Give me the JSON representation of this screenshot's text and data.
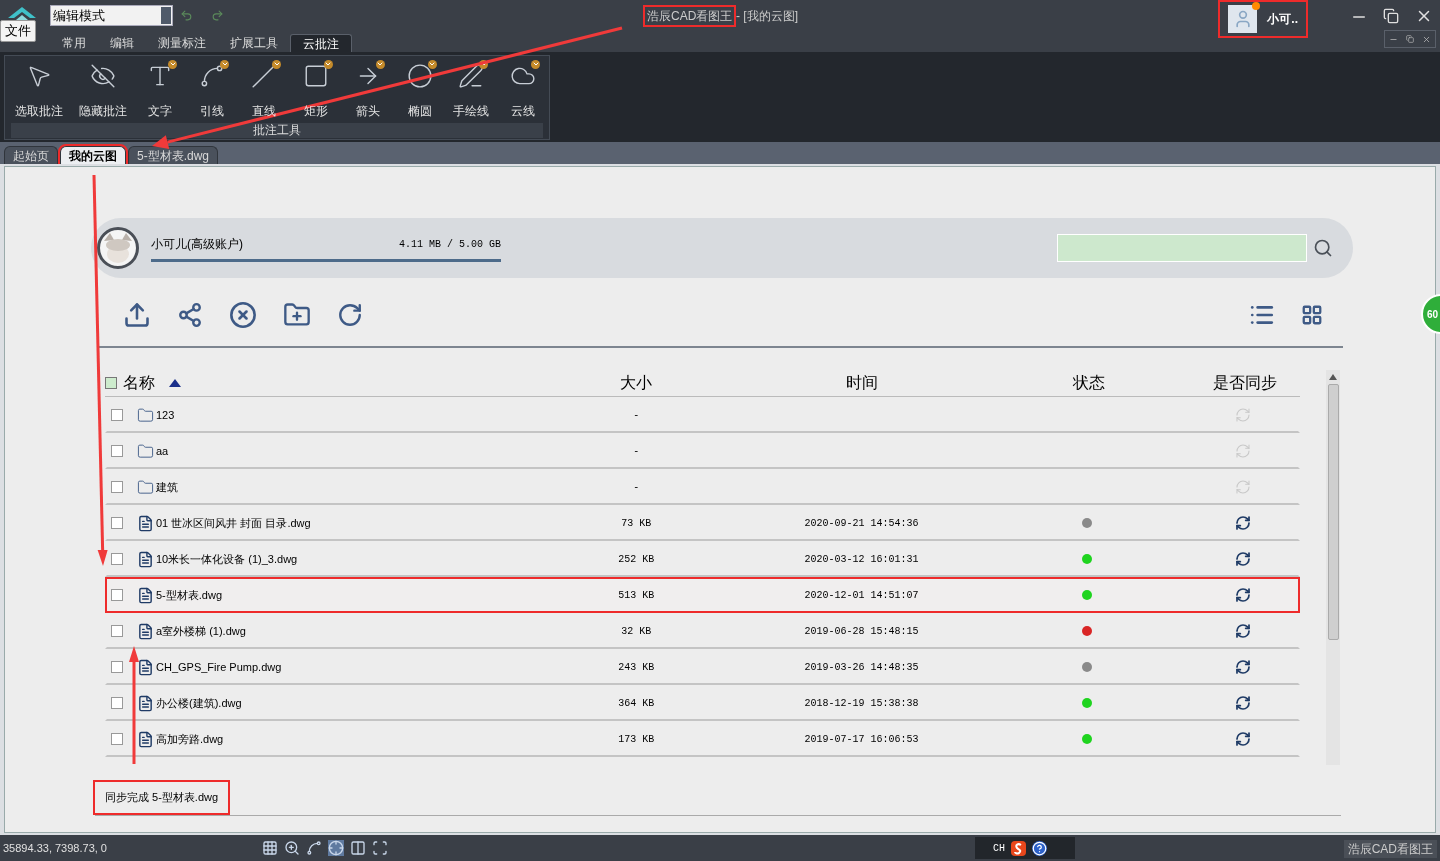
{
  "app": {
    "mode_select": "编辑模式",
    "title": {
      "text": "浩辰CAD看图王",
      "highlighted": true
    },
    "title_suffix": "- [我的云图]",
    "user": {
      "name": "小可..",
      "highlighted": true,
      "notification": true
    }
  },
  "file_button": "文件",
  "menu_tabs": [
    {
      "label": "常用",
      "selected": false
    },
    {
      "label": "编辑",
      "selected": false
    },
    {
      "label": "测量标注",
      "selected": false
    },
    {
      "label": "扩展工具",
      "selected": false
    },
    {
      "label": "云批注",
      "selected": true
    }
  ],
  "ribbon": {
    "tools": [
      {
        "label": "选取批注",
        "has_options": false
      },
      {
        "label": "隐藏批注",
        "has_options": false
      },
      {
        "label": "文字",
        "has_options": true
      },
      {
        "label": "引线",
        "has_options": true
      },
      {
        "label": "直线",
        "has_options": true
      },
      {
        "label": "矩形",
        "has_options": true
      },
      {
        "label": "箭头",
        "has_options": true
      },
      {
        "label": "椭圆",
        "has_options": true
      },
      {
        "label": "手绘线",
        "has_options": true
      },
      {
        "label": "云线",
        "has_options": true
      }
    ],
    "group_label": "批注工具"
  },
  "doc_tabs": [
    {
      "label": "起始页",
      "selected": false,
      "highlighted": false
    },
    {
      "label": "我的云图",
      "selected": true,
      "highlighted": true
    },
    {
      "label": "5-型材表.dwg",
      "selected": false,
      "highlighted": false
    }
  ],
  "account": {
    "name": "小可儿(高级账户)",
    "storage": "4.11 MB / 5.00 GB"
  },
  "side_badge": "60",
  "table": {
    "select_all": {
      "checked": false
    },
    "columns": [
      {
        "label": "名称",
        "sorted": true
      },
      {
        "label": "大小",
        "sorted": false
      },
      {
        "label": "时间",
        "sorted": false
      },
      {
        "label": "状态",
        "sorted": false
      },
      {
        "label": "是否同步",
        "sorted": false
      }
    ],
    "rows": [
      {
        "kind": "folder",
        "name": "123",
        "size": "-",
        "checked": false,
        "sync_enabled": false,
        "highlighted": false
      },
      {
        "kind": "folder",
        "name": "aa",
        "size": "-",
        "checked": false,
        "sync_enabled": false,
        "highlighted": false
      },
      {
        "kind": "folder",
        "name": "建筑",
        "size": "-",
        "checked": false,
        "sync_enabled": false,
        "highlighted": false
      },
      {
        "kind": "file",
        "name": "01 世冰区间风井 封面 目录.dwg",
        "size": "73 KB",
        "time": "2020-09-21 14:54:36",
        "color": "#8a8a8a",
        "checked": false,
        "sync_enabled": true,
        "highlighted": false
      },
      {
        "kind": "file",
        "name": "10米长一体化设备 (1)_3.dwg",
        "size": "252 KB",
        "time": "2020-03-12 16:01:31",
        "color": "#1fd41f",
        "checked": false,
        "sync_enabled": true,
        "highlighted": false
      },
      {
        "kind": "file",
        "name": "5-型材表.dwg",
        "size": "513 KB",
        "time": "2020-12-01 14:51:07",
        "color": "#1fd41f",
        "checked": false,
        "sync_enabled": true,
        "highlighted": true
      },
      {
        "kind": "file",
        "name": "a室外楼梯 (1).dwg",
        "size": "32 KB",
        "time": "2019-06-28 15:48:15",
        "color": "#d92525",
        "checked": false,
        "sync_enabled": true,
        "highlighted": false
      },
      {
        "kind": "file",
        "name": "CH_GPS_Fire Pump.dwg",
        "size": "243 KB",
        "time": "2019-03-26 14:48:35",
        "color": "#8a8a8a",
        "checked": false,
        "sync_enabled": true,
        "highlighted": false
      },
      {
        "kind": "file",
        "name": "办公楼(建筑).dwg",
        "size": "364 KB",
        "time": "2018-12-19 15:38:38",
        "color": "#1fd41f",
        "checked": false,
        "sync_enabled": true,
        "highlighted": false
      },
      {
        "kind": "file",
        "name": "高加旁路.dwg",
        "size": "173 KB",
        "time": "2019-07-17 16:06:53",
        "color": "#1fd41f",
        "checked": false,
        "sync_enabled": true,
        "highlighted": false
      }
    ]
  },
  "status_message": {
    "text": "同步完成 5-型材表.dwg",
    "highlighted": true
  },
  "status_bar": {
    "coords": "35894.33, 7398.73, 0",
    "ime": "CH",
    "app_name": "浩辰CAD看图王"
  }
}
